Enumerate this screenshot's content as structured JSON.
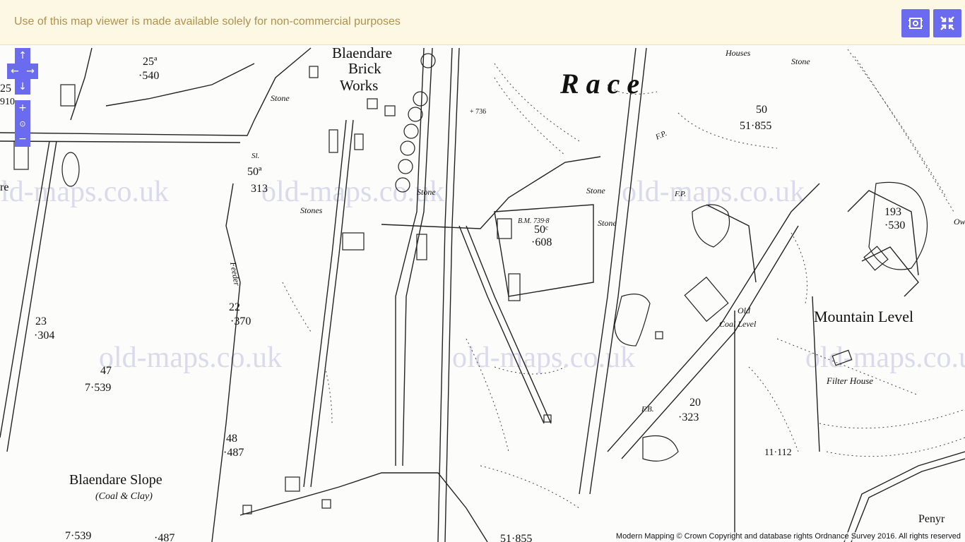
{
  "notice": {
    "text": "Use of this map viewer is made available solely for non-commercial purposes"
  },
  "controls": {
    "fit_icon": "fit-extent-icon",
    "exit_fullscreen_icon": "exit-fullscreen-icon",
    "pan_up": "↑",
    "pan_left": "←",
    "pan_right": "→",
    "pan_down": "↓",
    "zoom_in": "+",
    "zoom_reset": "⊙",
    "zoom_out": "−"
  },
  "attribution": "Modern Mapping © Crown Copyright and database rights Ordnance Survey 2016. All rights reserved",
  "watermark": "old-maps.co.uk",
  "map_labels": {
    "blaendare": "Blaendare",
    "brick": "Brick",
    "works": "Works",
    "race": "R a c e",
    "stone_1": "Stone",
    "stone_2": "Stone",
    "stone_3": "Stone",
    "stone_4": "Stone",
    "stones": "Stones",
    "stone_5": "Stone",
    "houses": "Houses",
    "p50_num": "50",
    "p50_area": "51·855",
    "p25a_num": "25ª",
    "p25a_area": "·540",
    "p25_num": "25",
    "p25_area": "910",
    "sl": "Sl.",
    "p50a_num": "50ª",
    "p50a_area": "313",
    "p22_num": "22",
    "p22_area": "·370",
    "feeder": "Feeder",
    "p23_num": "23",
    "p23_area": "·304",
    "p47_num": "47",
    "p47_area": "7·539",
    "p48_num": "48",
    "p48_area": "·487",
    "blaendare_slope": "Blaendare Slope",
    "coal_clay": "(Coal & Clay)",
    "area_bottom_1": "7·539",
    "area_bottom_2": "·487",
    "area_bottom_3": "51·855",
    "bm": "B.M. 739·8",
    "p50c_num": "50ᶜ",
    "p50c_area": "·608",
    "elev_736": "+ 736",
    "fp_1": "F.P.",
    "fp_2": "F.P.",
    "fb": "F.B.",
    "p193_num": "193",
    "p193_area": "·530",
    "mountain_level": "Mountain Level",
    "old_coal_level_1": "Old",
    "old_coal_level_2": "Coal Level",
    "filter_house": "Filter House",
    "p20_num": "20",
    "p20_area": "·323",
    "p11_area": "11·112",
    "re": "re",
    "penyr": "Penyr",
    "ow": "Ow"
  }
}
